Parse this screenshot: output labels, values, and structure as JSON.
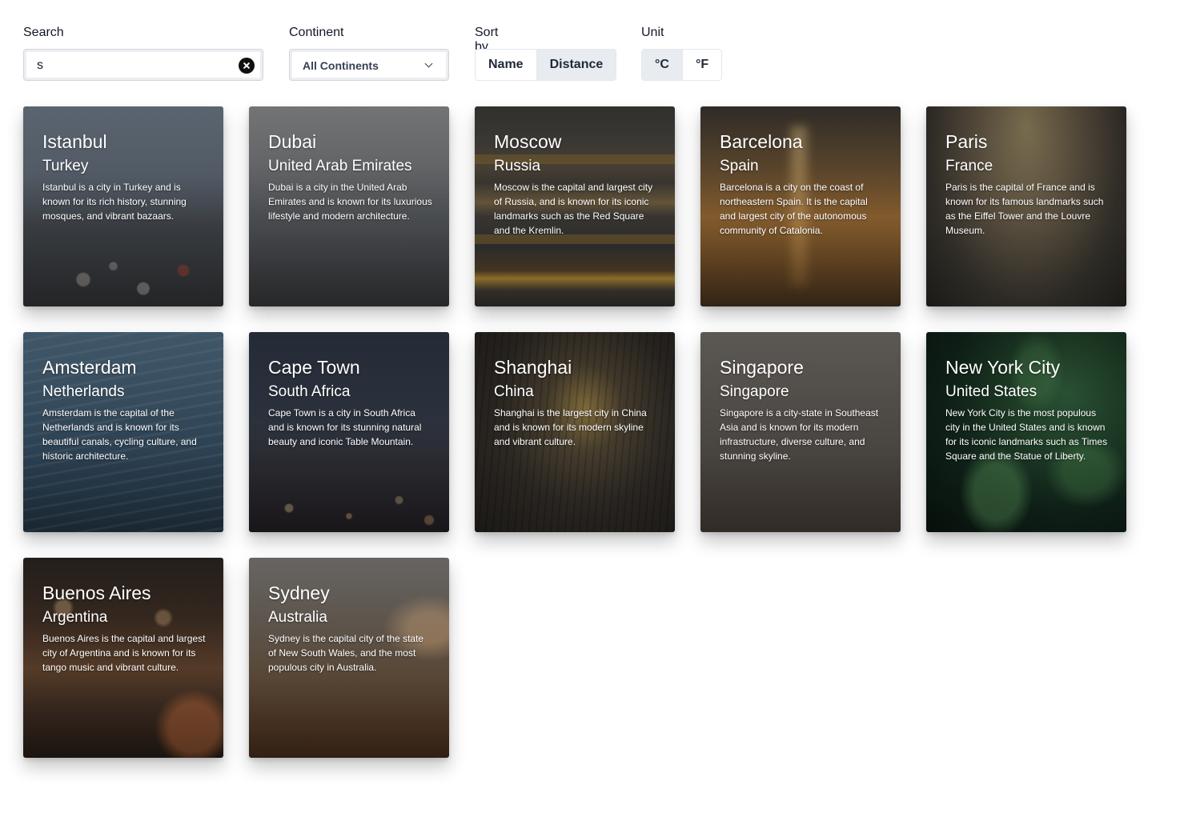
{
  "filters": {
    "search": {
      "label": "Search",
      "value": "s"
    },
    "continent": {
      "label": "Continent",
      "selected": "All Continents"
    },
    "sort": {
      "label": "Sort by",
      "options": [
        "Name",
        "Distance"
      ],
      "active": "Distance"
    },
    "unit": {
      "label": "Unit",
      "options": [
        "°C",
        "°F"
      ],
      "active": "°C"
    }
  },
  "colors": {
    "active_segment_bg": "#e8ecf1",
    "text": "#111827"
  },
  "cities": [
    {
      "city": "Istanbul",
      "country": "Turkey",
      "description": "Istanbul is a city in Turkey and is known for its rich history, stunning mosques, and vibrant bazaars."
    },
    {
      "city": "Dubai",
      "country": "United Arab Emirates",
      "description": "Dubai is a city in the United Arab Emirates and is known for its luxurious lifestyle and modern architecture."
    },
    {
      "city": "Moscow",
      "country": "Russia",
      "description": "Moscow is the capital and largest city of Russia, and is known for its iconic landmarks such as the Red Square and the Kremlin."
    },
    {
      "city": "Barcelona",
      "country": "Spain",
      "description": "Barcelona is a city on the coast of northeastern Spain. It is the capital and largest city of the autonomous community of Catalonia."
    },
    {
      "city": "Paris",
      "country": "France",
      "description": "Paris is the capital of France and is known for its famous landmarks such as the Eiffel Tower and the Louvre Museum."
    },
    {
      "city": "Amsterdam",
      "country": "Netherlands",
      "description": "Amsterdam is the capital of the Netherlands and is known for its beautiful canals, cycling culture, and historic architecture."
    },
    {
      "city": "Cape Town",
      "country": "South Africa",
      "description": "Cape Town is a city in South Africa and is known for its stunning natural beauty and iconic Table Mountain."
    },
    {
      "city": "Shanghai",
      "country": "China",
      "description": "Shanghai is the largest city in China and is known for its modern skyline and vibrant culture."
    },
    {
      "city": "Singapore",
      "country": "Singapore",
      "description": "Singapore is a city-state in Southeast Asia and is known for its modern infrastructure, diverse culture, and stunning skyline."
    },
    {
      "city": "New York City",
      "country": "United States",
      "description": "New York City is the most populous city in the United States and is known for its iconic landmarks such as Times Square and the Statue of Liberty."
    },
    {
      "city": "Buenos Aires",
      "country": "Argentina",
      "description": "Buenos Aires is the capital and largest city of Argentina and is known for its tango music and vibrant culture."
    },
    {
      "city": "Sydney",
      "country": "Australia",
      "description": "Sydney is the capital city of the state of New South Wales, and the most populous city in Australia."
    }
  ]
}
